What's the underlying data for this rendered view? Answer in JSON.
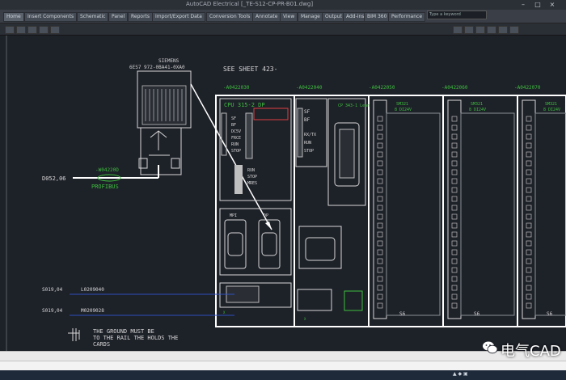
{
  "window": {
    "title": "AutoCAD Electrical  [_TE-S12-CP-PR-B01.dwg]",
    "controls": [
      "–",
      "□",
      "×"
    ]
  },
  "ribbon": {
    "tabs": [
      "Home",
      "Insert Components",
      "Schematic",
      "Panel",
      "Reports",
      "Import/Export Data",
      "Conversion Tools",
      "Annotate",
      "View",
      "Manage",
      "Output",
      "Add-ins",
      "BIM 360",
      "Performance"
    ],
    "active_tab": "Home",
    "search_placeholder": "Type a keyword"
  },
  "drawing": {
    "see_sheet": "SEE SHEET 423-",
    "siemens_label": "SIEMENS",
    "siemens_part": "6ES7 972-0BA41-0XA0",
    "bus_ref": "D052,06",
    "cable_tag": "-W04220D",
    "cable_label": "PROFIBUS",
    "rack_tags": [
      "-A0422030",
      "-A0422040",
      "-A0422050",
      "-A0422060",
      "-A0422070"
    ],
    "cpu_title": "CPU 315-2 DP",
    "cpu_leds": [
      "SF",
      "BF",
      "DC5V",
      "FRCE",
      "RUN",
      "STOP"
    ],
    "cpu_switch": [
      "RUN",
      "STOP",
      "MRES"
    ],
    "cpu_ports": [
      "MPI",
      "DP"
    ],
    "cp_leds": [
      "SF",
      "BF",
      "RX/TX",
      "RUN",
      "STOP"
    ],
    "cp_title": "CP 343-1 Lean",
    "sm_label": "SM321",
    "sm_sub": "8 DI24V",
    "slot_label": "S6",
    "left_refs": [
      {
        "ref": "S019,04",
        "tag": "L0209040"
      },
      {
        "ref": "S019,04",
        "tag": "M0209028"
      }
    ],
    "ground_note": [
      "THE GROUND MUST BE",
      "TO THE RAIL THE HOLDS THE",
      "CARDS"
    ]
  },
  "watermark": {
    "text": "电气CAD"
  },
  "colors": {
    "canvas": "#1d2128",
    "white_line": "#ffffff",
    "green_text": "#3fbf3f",
    "red_text": "#e04040",
    "blue_line": "#3050c0"
  }
}
